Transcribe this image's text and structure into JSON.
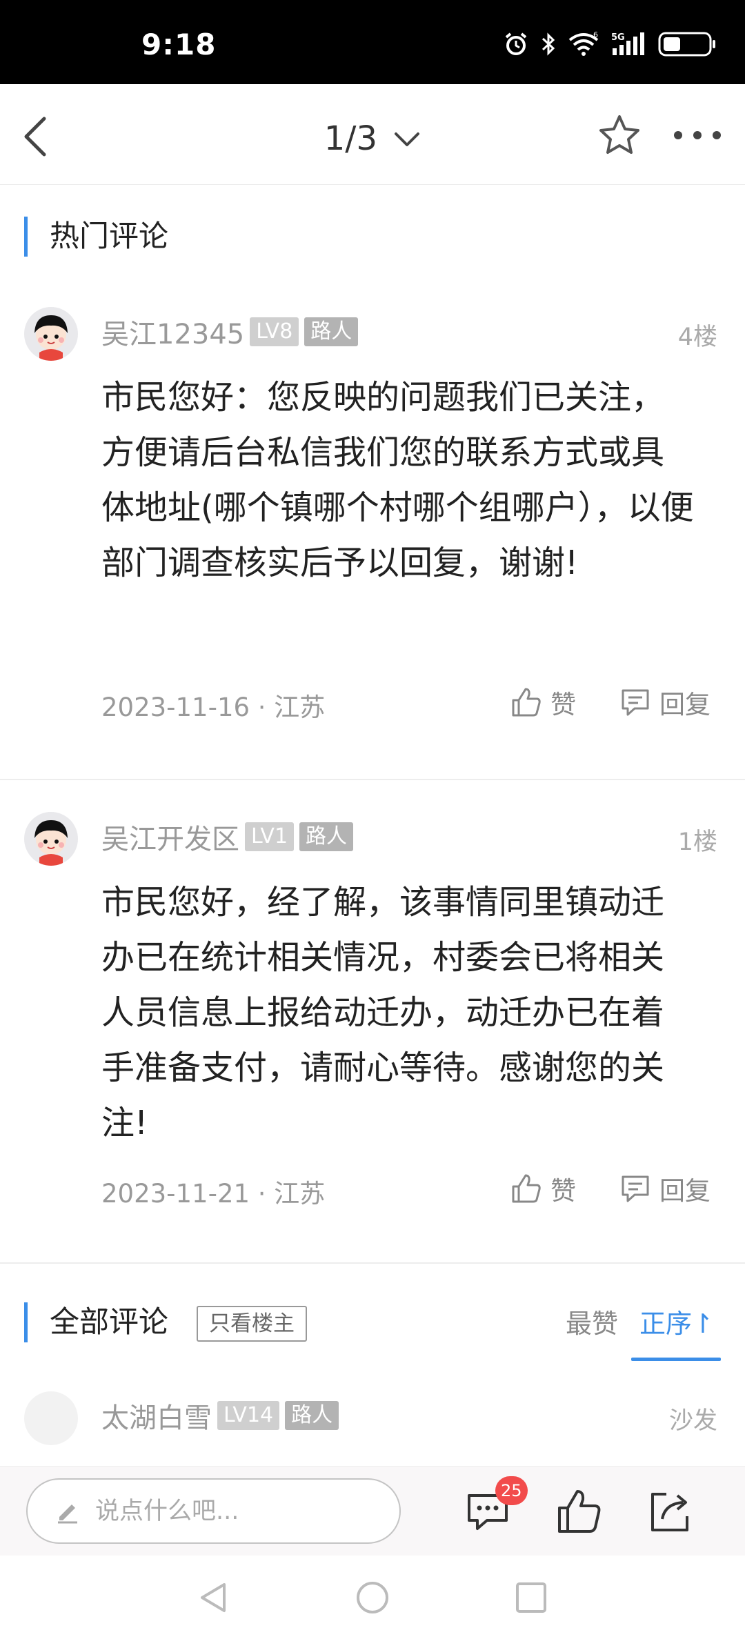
{
  "status_bar": {
    "time": "9:18",
    "signal_label": "5G",
    "sim_label": "6"
  },
  "nav": {
    "pager": "1/3"
  },
  "hot_section": {
    "title": "热门评论"
  },
  "hot_comments": [
    {
      "username": "吴江12345",
      "level": "LV8",
      "role": "路人",
      "floor": "4楼",
      "text": "市民您好：您反映的问题我们已关注，方便请后台私信我们您的联系方式或具体地址(哪个镇哪个村哪个组哪户），以便部门调查核实后予以回复，谢谢!",
      "date_location": "2023-11-16 · 江苏",
      "like_label": "赞",
      "reply_label": "回复"
    },
    {
      "username": "吴江开发区",
      "level": "LV1",
      "role": "路人",
      "floor": "1楼",
      "text": "市民您好，经了解，该事情同里镇动迁办已在统计相关情况，村委会已将相关人员信息上报给动迁办，动迁办已在着手准备支付，请耐心等待。感谢您的关注!",
      "date_location": "2023-11-21 · 江苏",
      "like_label": "赞",
      "reply_label": "回复"
    }
  ],
  "all_section": {
    "title": "全部评论",
    "only_owner": "只看楼主",
    "sort_hot": "最赞",
    "sort_order": "正序↾"
  },
  "all_comments": [
    {
      "username": "太湖白雪",
      "level": "LV14",
      "role": "路人",
      "floor": "沙发"
    }
  ],
  "bottom_bar": {
    "input_placeholder": "说点什么吧...",
    "comment_count": "25"
  },
  "colors": {
    "accent": "#3b8ee8",
    "badge_red": "#f24b4b"
  },
  "icons": [
    "back-icon",
    "chevron-down-icon",
    "star-icon",
    "more-icon",
    "thumb-up-icon",
    "reply-icon",
    "pencil-icon",
    "comment-icon",
    "share-icon"
  ]
}
